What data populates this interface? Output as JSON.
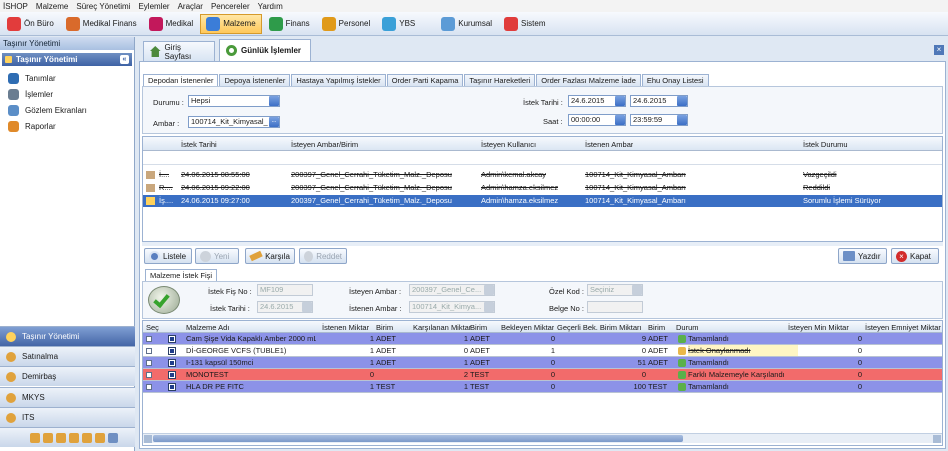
{
  "menubar": {
    "items": [
      "İSHOP",
      "Malzeme",
      "Süreç Yönetimi",
      "Eylemler",
      "Araçlar",
      "Pencereler",
      "Yardım"
    ]
  },
  "toolbar": {
    "items": [
      {
        "label": "Ön Büro",
        "icon": "home-icon",
        "color": "#e23c3c"
      },
      {
        "label": "Medikal Finans",
        "icon": "tools-icon",
        "color": "#d96a2b"
      },
      {
        "label": "Medikal",
        "icon": "medical-icon",
        "color": "#c2185b"
      },
      {
        "label": "Malzeme",
        "icon": "supply-icon",
        "color": "#3b7dd8",
        "active": true
      },
      {
        "label": "Finans",
        "icon": "finance-icon",
        "color": "#2e9b4a"
      },
      {
        "label": "Personel",
        "icon": "people-icon",
        "color": "#e09a1a"
      },
      {
        "label": "YBS",
        "icon": "report-icon",
        "color": "#3aa0d8"
      },
      {
        "label": "Kurumsal",
        "icon": "building-icon",
        "color": "#5c9bd6"
      },
      {
        "label": "Sistem",
        "icon": "system-icon",
        "color": "#e03c3c"
      }
    ]
  },
  "left": {
    "title": "Taşınır Yönetimi",
    "subtitle": "Taşınır Yönetimi",
    "items": [
      {
        "label": "Tanımlar",
        "icon": "definitions-icon"
      },
      {
        "label": "İşlemler",
        "icon": "operations-icon"
      },
      {
        "label": "Gözlem Ekranları",
        "icon": "monitor-icon"
      },
      {
        "label": "Raporlar",
        "icon": "reports-icon"
      }
    ],
    "nav": [
      {
        "label": "Taşınır Yönetimi",
        "active": true
      },
      {
        "label": "Satınalma"
      },
      {
        "label": "Demirbaş"
      },
      {
        "label": "MKYS"
      },
      {
        "label": "ITS"
      }
    ]
  },
  "tabs": {
    "home": "Giriş Sayfası",
    "active": "Günlük İşlemler"
  },
  "subtabs": [
    "Depodan İstenenler",
    "Depoya İstenenler",
    "Hastaya Yapılmış İstekler",
    "Order Parti Kapama",
    "Taşınır Hareketleri",
    "Order Fazlası Malzeme İade",
    "Ehu Onay Listesi"
  ],
  "filters": {
    "durum_label": "Durumu :",
    "durum_value": "Hepsi",
    "ambar_label": "Ambar :",
    "ambar_value": "100714_Kit_Kimyasal_",
    "istek_tarihi_label": "İstek Tarihi :",
    "date_from": "24.6.2015",
    "date_to": "24.6.2015",
    "saat_label": "Saat :",
    "time_from": "00:00:00",
    "time_to": "23:59:59"
  },
  "top_grid": {
    "headers": [
      "İstek Tarihi",
      "İsteyen Ambar/Birim",
      "İsteyen Kullanıcı",
      "İstenen Ambar",
      "İstek Durumu"
    ],
    "rows": [
      {
        "mark": "İ....",
        "date": "24.06.2015 08:55:00",
        "ambar": "200397_Genel_Cerrahi_Tüketim_Malz._Deposu",
        "user": "Admin\\kemal.akcay",
        "istenen": "100714_Kit_Kimyasal_Ambarı",
        "durum": "Vazgeçildi",
        "strike": true
      },
      {
        "mark": "R....",
        "date": "24.06.2015 09:22:00",
        "ambar": "200397_Genel_Cerrahi_Tüketim_Malz._Deposu",
        "user": "Admin\\hamza.eksilmez",
        "istenen": "100714_Kit_Kimyasal_Ambarı",
        "durum": "Reddildi",
        "strike": true
      },
      {
        "mark": "İş....",
        "date": "24.06.2015 09:27:00",
        "ambar": "200397_Genel_Cerrahi_Tüketim_Malz._Deposu",
        "user": "Admin\\hamza.eksilmez",
        "istenen": "100714_Kit_Kimyasal_Ambarı",
        "durum": "Sorumlu İşlemi Sürüyor",
        "selected": true
      }
    ]
  },
  "actions": {
    "listele": "Listele",
    "yeni": "Yeni",
    "karsila": "Karşıla",
    "reddet": "Reddet",
    "yazdir": "Yazdır",
    "kapat": "Kapat"
  },
  "fis": {
    "tab": "Malzeme İstek Fişi",
    "fis_no_label": "İstek Fiş No :",
    "fis_no": "MF109",
    "tarih_label": "İstek Tarihi :",
    "tarih": "24.6.2015",
    "isteyen_label": "İsteyen Ambar :",
    "isteyen": "200397_Genel_Ce...",
    "istenen_label": "İstenen Ambar :",
    "istenen": "100714_Kit_Kimya...",
    "ozel_kod_label": "Özel Kod :",
    "ozel_kod": "Seçiniz",
    "belge_no_label": "Belge No :",
    "belge_no": ""
  },
  "detail_grid": {
    "headers": [
      "Seç",
      "Malzeme Adı",
      "İstenen Miktar",
      "Birim",
      "Karşılanan Miktar",
      "Birim",
      "Bekleyen Miktar",
      "Geçerli Bek. Birim Miktarı",
      "Birim",
      "Durum",
      "İsteyen Min Miktar",
      "İsteyen Emniyet Miktar"
    ],
    "rows": [
      {
        "name": "Cam Şişe Vida Kapaklı Amber 2000 mL",
        "istenen": "1",
        "birim1": "ADET",
        "karsilanan": "1",
        "birim2": "ADET",
        "bekleyen": "0",
        "gecerli": "9",
        "birim3": "ADET",
        "durum": "Tamamlandı",
        "min": "0",
        "bg": "#8c92e8"
      },
      {
        "name": "Dİ-GEORGE VCFS (TUBLE1)",
        "istenen": "1",
        "birim1": "ADET",
        "karsilanan": "0",
        "birim2": "ADET",
        "bekleyen": "1",
        "gecerli": "0",
        "birim3": "ADET",
        "durum": "İstek Onaylanmadı",
        "min": "0",
        "bg": "#ffffff",
        "durum_bg": "#fff6c4",
        "strike_durum": true
      },
      {
        "name": "I-131 kapsül 150mci",
        "istenen": "1",
        "birim1": "ADET",
        "karsilanan": "1",
        "birim2": "ADET",
        "bekleyen": "0",
        "gecerli": "51",
        "birim3": "ADET",
        "durum": "Tamamlandı",
        "min": "0",
        "bg": "#8c92e8"
      },
      {
        "name": "MONOTEST",
        "istenen": "0",
        "birim1": "",
        "karsilanan": "2",
        "birim2": "TEST",
        "bekleyen": "0",
        "gecerli": "0",
        "birim3": "",
        "durum": "Farklı Malzemeyle Karşılandı",
        "min": "0",
        "bg": "#f26b6b"
      },
      {
        "name": "HLA DR PE FITC",
        "istenen": "1",
        "birim1": "TEST",
        "karsilanan": "1",
        "birim2": "TEST",
        "bekleyen": "0",
        "gecerli": "100",
        "birim3": "TEST",
        "durum": "Tamamlandı",
        "min": "0",
        "bg": "#8c92e8"
      }
    ]
  }
}
